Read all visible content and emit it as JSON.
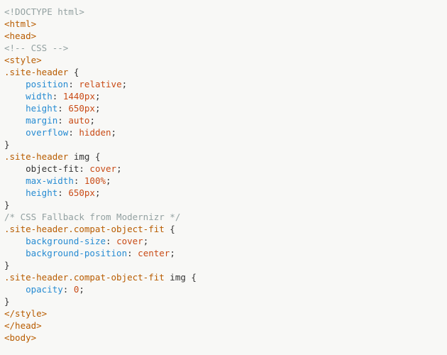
{
  "lines": [
    {
      "indent": 0,
      "spans": [
        {
          "cls": "t-muted",
          "t": "<!DOCTYPE html>"
        }
      ]
    },
    {
      "indent": 0,
      "spans": [
        {
          "cls": "t-tag",
          "t": "<html>"
        }
      ]
    },
    {
      "indent": 0,
      "spans": [
        {
          "cls": "t-tag",
          "t": "<head>"
        }
      ]
    },
    {
      "indent": 0,
      "spans": [
        {
          "cls": "t-muted",
          "t": "<!-- CSS -->"
        }
      ]
    },
    {
      "indent": 0,
      "spans": [
        {
          "cls": "t-tag",
          "t": "<style>"
        }
      ]
    },
    {
      "indent": 0,
      "spans": [
        {
          "cls": "t-sel",
          "t": ".site-header"
        },
        {
          "cls": "t-punc",
          "t": " {"
        }
      ]
    },
    {
      "indent": 1,
      "spans": [
        {
          "cls": "t-prop",
          "t": "position"
        },
        {
          "cls": "t-punc",
          "t": ": "
        },
        {
          "cls": "t-val",
          "t": "relative"
        },
        {
          "cls": "t-punc",
          "t": ";"
        }
      ]
    },
    {
      "indent": 1,
      "spans": [
        {
          "cls": "t-prop",
          "t": "width"
        },
        {
          "cls": "t-punc",
          "t": ": "
        },
        {
          "cls": "t-val",
          "t": "1440px"
        },
        {
          "cls": "t-punc",
          "t": ";"
        }
      ]
    },
    {
      "indent": 1,
      "spans": [
        {
          "cls": "t-prop",
          "t": "height"
        },
        {
          "cls": "t-punc",
          "t": ": "
        },
        {
          "cls": "t-val",
          "t": "650px"
        },
        {
          "cls": "t-punc",
          "t": ";"
        }
      ]
    },
    {
      "indent": 1,
      "spans": [
        {
          "cls": "t-prop",
          "t": "margin"
        },
        {
          "cls": "t-punc",
          "t": ": "
        },
        {
          "cls": "t-val",
          "t": "auto"
        },
        {
          "cls": "t-punc",
          "t": ";"
        }
      ]
    },
    {
      "indent": 1,
      "spans": [
        {
          "cls": "t-prop",
          "t": "overflow"
        },
        {
          "cls": "t-punc",
          "t": ": "
        },
        {
          "cls": "t-val",
          "t": "hidden"
        },
        {
          "cls": "t-punc",
          "t": ";"
        }
      ]
    },
    {
      "indent": 0,
      "spans": [
        {
          "cls": "t-punc",
          "t": "}"
        }
      ]
    },
    {
      "indent": 0,
      "spans": [
        {
          "cls": "t-sel",
          "t": ".site-header"
        },
        {
          "cls": "t-punc",
          "t": " img {"
        }
      ]
    },
    {
      "indent": 1,
      "spans": [
        {
          "cls": "t-punc",
          "t": "object-fit: "
        },
        {
          "cls": "t-val",
          "t": "cover"
        },
        {
          "cls": "t-punc",
          "t": ";"
        }
      ]
    },
    {
      "indent": 1,
      "spans": [
        {
          "cls": "t-prop",
          "t": "max-width"
        },
        {
          "cls": "t-punc",
          "t": ": "
        },
        {
          "cls": "t-val",
          "t": "100%"
        },
        {
          "cls": "t-punc",
          "t": ";"
        }
      ]
    },
    {
      "indent": 1,
      "spans": [
        {
          "cls": "t-prop",
          "t": "height"
        },
        {
          "cls": "t-punc",
          "t": ": "
        },
        {
          "cls": "t-val",
          "t": "650px"
        },
        {
          "cls": "t-punc",
          "t": ";"
        }
      ]
    },
    {
      "indent": 0,
      "spans": [
        {
          "cls": "t-punc",
          "t": "}"
        }
      ]
    },
    {
      "indent": 0,
      "spans": [
        {
          "cls": "t-muted",
          "t": "/* CSS Fallback from Modernizr */"
        }
      ]
    },
    {
      "indent": 0,
      "spans": [
        {
          "cls": "t-sel",
          "t": ".site-header.compat-object-fit"
        },
        {
          "cls": "t-punc",
          "t": " {"
        }
      ]
    },
    {
      "indent": 1,
      "spans": [
        {
          "cls": "t-prop",
          "t": "background-size"
        },
        {
          "cls": "t-punc",
          "t": ": "
        },
        {
          "cls": "t-val",
          "t": "cover"
        },
        {
          "cls": "t-punc",
          "t": ";"
        }
      ]
    },
    {
      "indent": 1,
      "spans": [
        {
          "cls": "t-prop",
          "t": "background-position"
        },
        {
          "cls": "t-punc",
          "t": ": "
        },
        {
          "cls": "t-val",
          "t": "center"
        },
        {
          "cls": "t-punc",
          "t": ";"
        }
      ]
    },
    {
      "indent": 0,
      "spans": [
        {
          "cls": "t-punc",
          "t": "}"
        }
      ]
    },
    {
      "indent": 0,
      "spans": [
        {
          "cls": "t-sel",
          "t": ".site-header.compat-object-fit"
        },
        {
          "cls": "t-punc",
          "t": " img {"
        }
      ]
    },
    {
      "indent": 1,
      "spans": [
        {
          "cls": "t-prop",
          "t": "opacity"
        },
        {
          "cls": "t-punc",
          "t": ": "
        },
        {
          "cls": "t-val",
          "t": "0"
        },
        {
          "cls": "t-punc",
          "t": ";"
        }
      ]
    },
    {
      "indent": 0,
      "spans": [
        {
          "cls": "t-punc",
          "t": "}"
        }
      ]
    },
    {
      "indent": 0,
      "spans": [
        {
          "cls": "t-tag",
          "t": "</style>"
        }
      ]
    },
    {
      "indent": 0,
      "spans": [
        {
          "cls": "t-tag",
          "t": "</head>"
        }
      ]
    },
    {
      "indent": 0,
      "spans": [
        {
          "cls": "t-tag",
          "t": "<body>"
        }
      ]
    }
  ],
  "indent_unit": "    "
}
